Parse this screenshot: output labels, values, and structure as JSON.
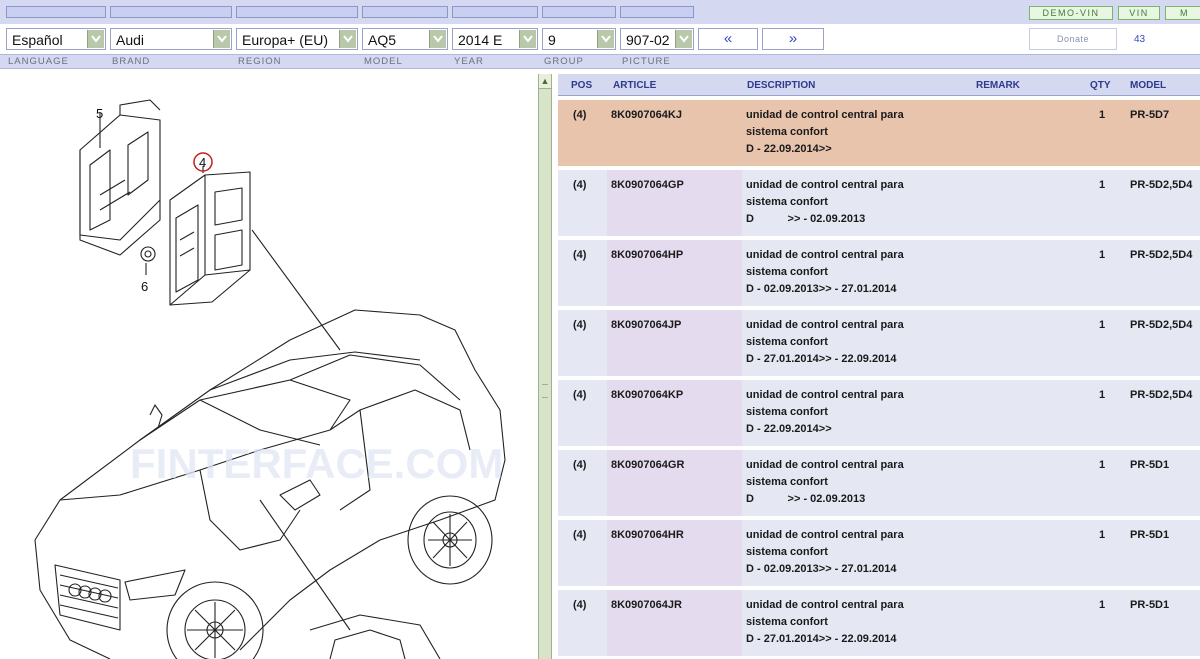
{
  "toolbar": {
    "demo_vin": "DEMO-VIN",
    "vin": "VIN",
    "more": "M"
  },
  "selectors": {
    "language": "Español",
    "brand": "Audi",
    "region": "Europa+ (EU)",
    "model": "AQ5",
    "year": "2014  E",
    "group": "9",
    "picture": "907-02"
  },
  "nav": {
    "prev": "«",
    "next": "»"
  },
  "donate_label": "Donate",
  "count": "43",
  "labels": {
    "language": "LANGUAGE",
    "brand": "BRAND",
    "region": "REGION",
    "model": "MODEL",
    "year": "YEAR",
    "group": "GROUP",
    "picture": "PICTURE"
  },
  "figure": {
    "callouts": [
      "5",
      "4",
      "6"
    ],
    "watermark": "FINTERFACE.COM"
  },
  "table": {
    "headers": {
      "pos": "POS",
      "article": "ARTICLE",
      "description": "DESCRIPTION",
      "remark": "REMARK",
      "qty": "QTY",
      "model": "MODEL"
    },
    "rows": [
      {
        "pos": "(4)",
        "article": "8K0907064KJ",
        "desc1": "unidad de control central para",
        "desc2": "sistema confort",
        "desc3": "D - 22.09.2014>>",
        "qty": "1",
        "model": "PR-5D7",
        "selected": true
      },
      {
        "pos": "(4)",
        "article": "8K0907064GP",
        "desc1": "unidad de control central para",
        "desc2": "sistema confort",
        "desc3": "D           >> - 02.09.2013",
        "qty": "1",
        "model": "PR-5D2,5D4"
      },
      {
        "pos": "(4)",
        "article": "8K0907064HP",
        "desc1": "unidad de control central para",
        "desc2": "sistema confort",
        "desc3": "D - 02.09.2013>> - 27.01.2014",
        "qty": "1",
        "model": "PR-5D2,5D4"
      },
      {
        "pos": "(4)",
        "article": "8K0907064JP",
        "desc1": "unidad de control central para",
        "desc2": "sistema confort",
        "desc3": "D - 27.01.2014>> - 22.09.2014",
        "qty": "1",
        "model": "PR-5D2,5D4"
      },
      {
        "pos": "(4)",
        "article": "8K0907064KP",
        "desc1": "unidad de control central para",
        "desc2": "sistema confort",
        "desc3": "D - 22.09.2014>>",
        "qty": "1",
        "model": "PR-5D2,5D4"
      },
      {
        "pos": "(4)",
        "article": "8K0907064GR",
        "desc1": "unidad de control central para",
        "desc2": "sistema confort",
        "desc3": "D           >> - 02.09.2013",
        "qty": "1",
        "model": "PR-5D1"
      },
      {
        "pos": "(4)",
        "article": "8K0907064HR",
        "desc1": "unidad de control central para",
        "desc2": "sistema confort",
        "desc3": "D - 02.09.2013>> - 27.01.2014",
        "qty": "1",
        "model": "PR-5D1"
      },
      {
        "pos": "(4)",
        "article": "8K0907064JR",
        "desc1": "unidad de control central para",
        "desc2": "sistema confort",
        "desc3": "D - 27.01.2014>> - 22.09.2014",
        "qty": "1",
        "model": "PR-5D1"
      }
    ]
  }
}
